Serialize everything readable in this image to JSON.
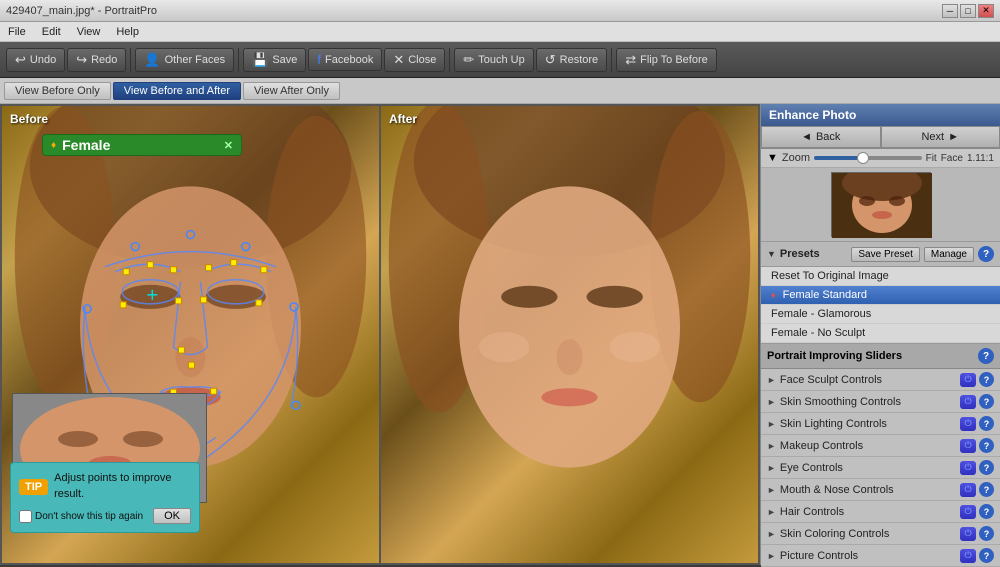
{
  "window": {
    "title": "429407_main.jpg* - PortraitPro"
  },
  "titlebar": {
    "minimize": "─",
    "maximize": "□",
    "close": "✕"
  },
  "menu": {
    "items": [
      "File",
      "Edit",
      "View",
      "Help"
    ]
  },
  "toolbar": {
    "undo": "Undo",
    "redo": "Redo",
    "other_faces": "Other Faces",
    "save": "Save",
    "facebook": "Facebook",
    "close": "Close",
    "touch_up": "Touch Up",
    "restore": "Restore",
    "flip": "Flip To Before"
  },
  "view_buttons": {
    "before_only": "View Before Only",
    "before_after": "View Before and After",
    "after_only": "View After Only"
  },
  "panels": {
    "before_label": "Before",
    "after_label": "After"
  },
  "female_label": {
    "text": "Female",
    "pin": "♦"
  },
  "tip": {
    "badge": "TIP",
    "text": "Adjust points to improve result.",
    "checkbox_label": "Don't show this tip again",
    "ok_btn": "OK"
  },
  "right_panel": {
    "header": "Enhance Photo",
    "back": "Back",
    "next": "Next",
    "zoom_label": "Zoom",
    "fit": "Fit",
    "face": "Face",
    "zoom_value": "1.11:1",
    "presets_label": "Presets",
    "save_preset": "Save Preset",
    "manage": "Manage",
    "presets": [
      {
        "label": "Reset To Original Image",
        "active": false,
        "pin": false
      },
      {
        "label": "Female Standard",
        "active": true,
        "pin": true
      },
      {
        "label": "Female - Glamorous",
        "active": false,
        "pin": false
      },
      {
        "label": "Female - No Sculpt",
        "active": false,
        "pin": false
      }
    ],
    "sliders_header": "Portrait Improving Sliders",
    "sliders": [
      {
        "name": "Face Sculpt Controls"
      },
      {
        "name": "Skin Smoothing Controls"
      },
      {
        "name": "Skin Lighting Controls"
      },
      {
        "name": "Makeup Controls"
      },
      {
        "name": "Eye Controls"
      },
      {
        "name": "Mouth & Nose Controls"
      },
      {
        "name": "Hair Controls"
      },
      {
        "name": "Skin Coloring Controls"
      },
      {
        "name": "Picture Controls"
      }
    ]
  }
}
